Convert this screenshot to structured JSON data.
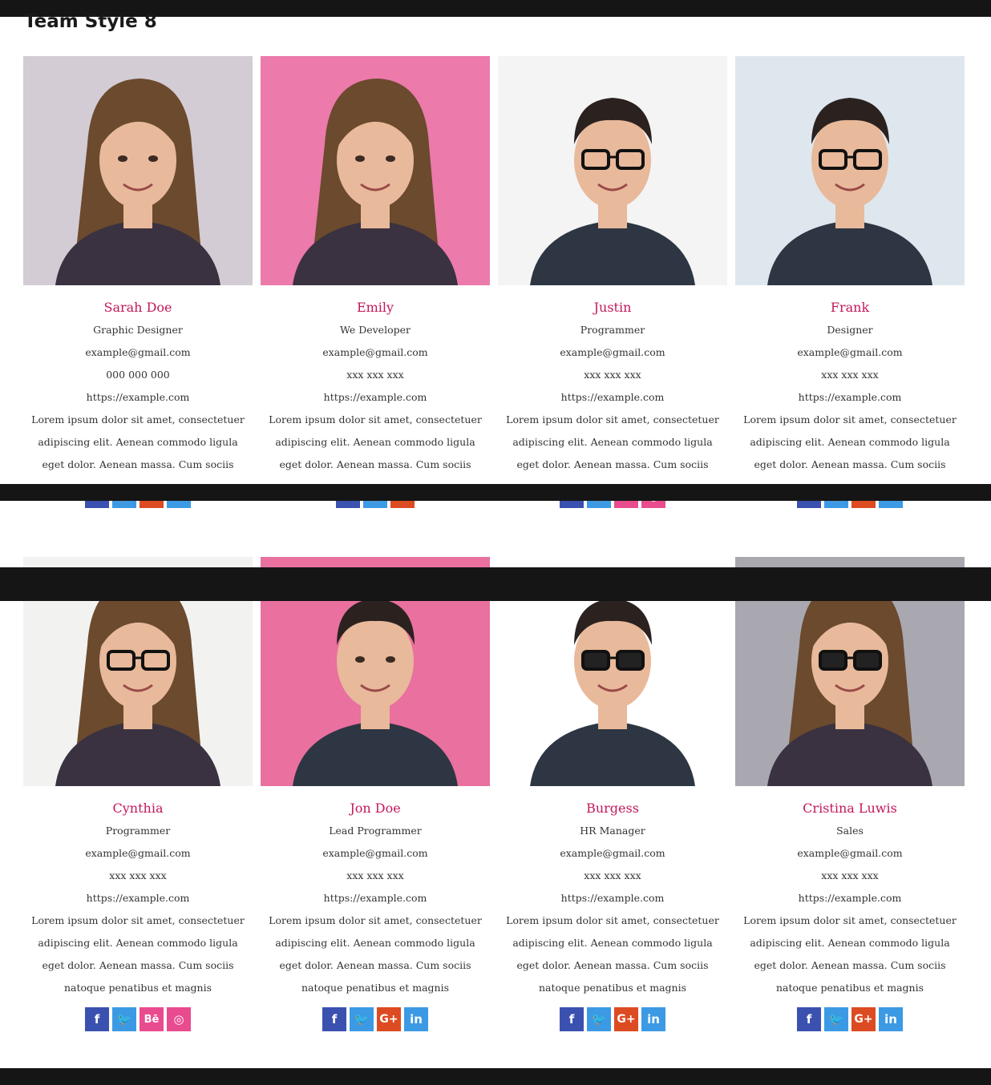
{
  "page": {
    "title": "Team Style 8"
  },
  "colors": {
    "name": "#c2185b",
    "facebook": "#3b51b0",
    "twitter": "#3c9ae4",
    "googleplus": "#dd4b22",
    "linkedin": "#3c9ae4",
    "behance": "#e94b8f",
    "dribbble": "#e94b8f",
    "dark_bar": "#151515"
  },
  "social_glyphs": {
    "facebook": "f",
    "twitter": "🐦",
    "googleplus": "G+",
    "linkedin": "in",
    "behance": "Bē",
    "dribbble": "◎"
  },
  "members": [
    {
      "name": "Sarah Doe",
      "role": "Graphic Designer",
      "email": "example@gmail.com",
      "phone": "000 000 000",
      "website": "https://example.com",
      "bio": [
        "Lorem ipsum dolor sit amet, consectetuer",
        "adipiscing elit. Aenean commodo ligula",
        "eget dolor. Aenean massa. Cum sociis"
      ],
      "photo": "woman-portrait",
      "photo_bg": "#d3ccd4",
      "social": [
        "facebook",
        "twitter",
        "googleplus",
        "linkedin"
      ]
    },
    {
      "name": "Emily",
      "role": "We Developer",
      "email": "example@gmail.com",
      "phone": "xxx xxx xxx",
      "website": "https://example.com",
      "bio": [
        "Lorem ipsum dolor sit amet, consectetuer",
        "adipiscing elit. Aenean commodo ligula",
        "eget dolor. Aenean massa. Cum sociis"
      ],
      "photo": "woman-portrait",
      "photo_bg": "#ec7aab",
      "social": [
        "facebook",
        "twitter",
        "googleplus"
      ]
    },
    {
      "name": "Justin",
      "role": "Programmer",
      "email": "example@gmail.com",
      "phone": "xxx xxx xxx",
      "website": "https://example.com",
      "bio": [
        "Lorem ipsum dolor sit amet, consectetuer",
        "adipiscing elit. Aenean commodo ligula",
        "eget dolor. Aenean massa. Cum sociis"
      ],
      "photo": "man-glasses-portrait",
      "photo_bg": "#f4f4f4",
      "social": [
        "facebook",
        "twitter",
        "behance",
        "dribbble"
      ]
    },
    {
      "name": "Frank",
      "role": "Designer",
      "email": "example@gmail.com",
      "phone": "xxx xxx xxx",
      "website": "https://example.com",
      "bio": [
        "Lorem ipsum dolor sit amet, consectetuer",
        "adipiscing elit. Aenean commodo ligula",
        "eget dolor. Aenean massa. Cum sociis"
      ],
      "photo": "man-glasses-portrait",
      "photo_bg": "#dfe7ee",
      "social": [
        "facebook",
        "twitter",
        "googleplus",
        "linkedin"
      ]
    },
    {
      "name": "Cynthia",
      "role": "Programmer",
      "email": "example@gmail.com",
      "phone": "xxx xxx xxx",
      "website": "https://example.com",
      "bio": [
        "Lorem ipsum dolor sit amet, consectetuer",
        "adipiscing elit. Aenean commodo ligula",
        "eget dolor. Aenean massa. Cum sociis",
        "natoque penatibus et magnis"
      ],
      "photo": "woman-glasses-portrait",
      "photo_bg": "#f2f2f0",
      "social": [
        "facebook",
        "twitter",
        "behance",
        "dribbble"
      ]
    },
    {
      "name": "Jon Doe",
      "role": "Lead Programmer",
      "email": "example@gmail.com",
      "phone": "xxx xxx xxx",
      "website": "https://example.com",
      "bio": [
        "Lorem ipsum dolor sit amet, consectetuer",
        "adipiscing elit. Aenean commodo ligula",
        "eget dolor. Aenean massa. Cum sociis",
        "natoque penatibus et magnis"
      ],
      "photo": "man-portrait",
      "photo_bg": "#e9709f",
      "social": [
        "facebook",
        "twitter",
        "googleplus",
        "linkedin"
      ]
    },
    {
      "name": "Burgess",
      "role": "HR Manager",
      "email": "example@gmail.com",
      "phone": "xxx xxx xxx",
      "website": "https://example.com",
      "bio": [
        "Lorem ipsum dolor sit amet, consectetuer",
        "adipiscing elit. Aenean commodo ligula",
        "eget dolor. Aenean massa. Cum sociis",
        "natoque penatibus et magnis"
      ],
      "photo": "man-sunglasses-portrait",
      "photo_bg": "#ffffff",
      "social": [
        "facebook",
        "twitter",
        "googleplus",
        "linkedin"
      ]
    },
    {
      "name": "Cristina Luwis",
      "role": "Sales",
      "email": "example@gmail.com",
      "phone": "xxx xxx xxx",
      "website": "https://example.com",
      "bio": [
        "Lorem ipsum dolor sit amet, consectetuer",
        "adipiscing elit. Aenean commodo ligula",
        "eget dolor. Aenean massa. Cum sociis",
        "natoque penatibus et magnis"
      ],
      "photo": "woman-sunglasses-portrait",
      "photo_bg": "#a9a8b0",
      "social": [
        "facebook",
        "twitter",
        "googleplus",
        "linkedin"
      ]
    }
  ]
}
